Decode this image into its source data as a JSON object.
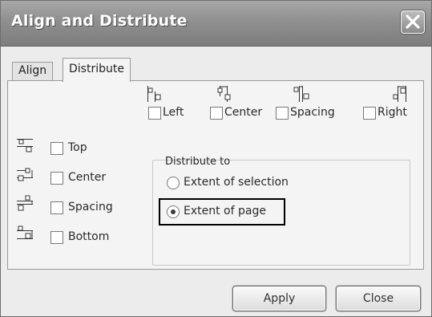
{
  "window": {
    "title": "Align and Distribute"
  },
  "tabs": [
    {
      "label": "Align",
      "active": false
    },
    {
      "label": "Distribute",
      "active": true
    }
  ],
  "horizontal": [
    {
      "label": "Left",
      "icon": "distribute-left-icon",
      "checked": false
    },
    {
      "label": "Center",
      "icon": "distribute-center-h-icon",
      "checked": false
    },
    {
      "label": "Spacing",
      "icon": "distribute-spacing-h-icon",
      "checked": false
    },
    {
      "label": "Right",
      "icon": "distribute-right-icon",
      "checked": false
    }
  ],
  "vertical": [
    {
      "label": "Top",
      "icon": "distribute-top-icon",
      "checked": false
    },
    {
      "label": "Center",
      "icon": "distribute-center-v-icon",
      "checked": false
    },
    {
      "label": "Spacing",
      "icon": "distribute-spacing-v-icon",
      "checked": false
    },
    {
      "label": "Bottom",
      "icon": "distribute-bottom-icon",
      "checked": false
    }
  ],
  "distribute_to": {
    "heading": "Distribute to",
    "options": [
      {
        "label": "Extent of selection",
        "selected": false
      },
      {
        "label": "Extent of page",
        "selected": true
      }
    ]
  },
  "buttons": {
    "apply": "Apply",
    "close": "Close"
  },
  "colors": {
    "titlebar": "#8f8f8f",
    "highlight_border": "#000000"
  }
}
